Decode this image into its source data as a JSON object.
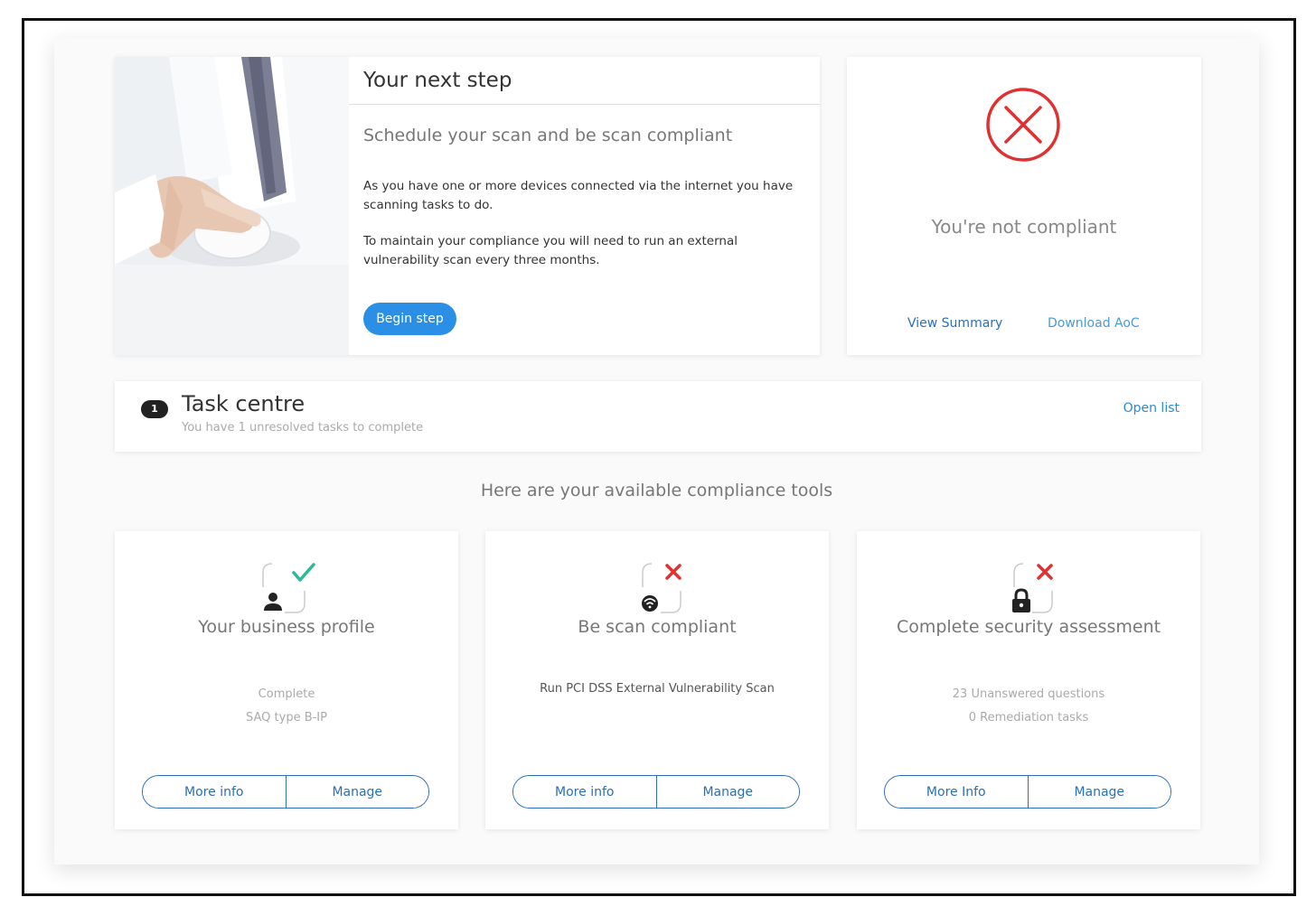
{
  "next_step": {
    "title": "Your next step",
    "subtitle": "Schedule your scan and be scan compliant",
    "para1": "As you have one or more devices connected via the internet you have scanning tasks to do.",
    "para2": "To maintain your compliance you will need to run an external vulnerability scan every three months.",
    "button": "Begin step"
  },
  "status": {
    "text": "You're not compliant",
    "links": [
      "View Summary",
      "Download AoC"
    ],
    "accent": "#e03030"
  },
  "task_centre": {
    "count": "1",
    "title": "Task centre",
    "subtitle": "You have 1 unresolved tasks to complete",
    "link": "Open list"
  },
  "tools_heading": "Here are your available compliance tools",
  "tools": [
    {
      "title": "Your business profile",
      "lines": [
        "Complete",
        "SAQ type B-IP"
      ],
      "status_icon": "check-icon",
      "icon": "user-icon",
      "more": "More info",
      "manage": "Manage"
    },
    {
      "title": "Be scan compliant",
      "lines": [
        "Run PCI DSS External Vulnerability Scan"
      ],
      "status_icon": "cross-icon",
      "icon": "wifi-icon",
      "more": "More info",
      "manage": "Manage"
    },
    {
      "title": "Complete security assessment",
      "lines": [
        "23 Unanswered questions",
        "0 Remediation tasks"
      ],
      "status_icon": "cross-icon",
      "icon": "lock-icon",
      "more": "More Info",
      "manage": "Manage"
    }
  ],
  "colors": {
    "primary": "#2b8fe6",
    "link": "#2a6fb8",
    "success": "#2fb89a",
    "danger": "#e03030"
  }
}
